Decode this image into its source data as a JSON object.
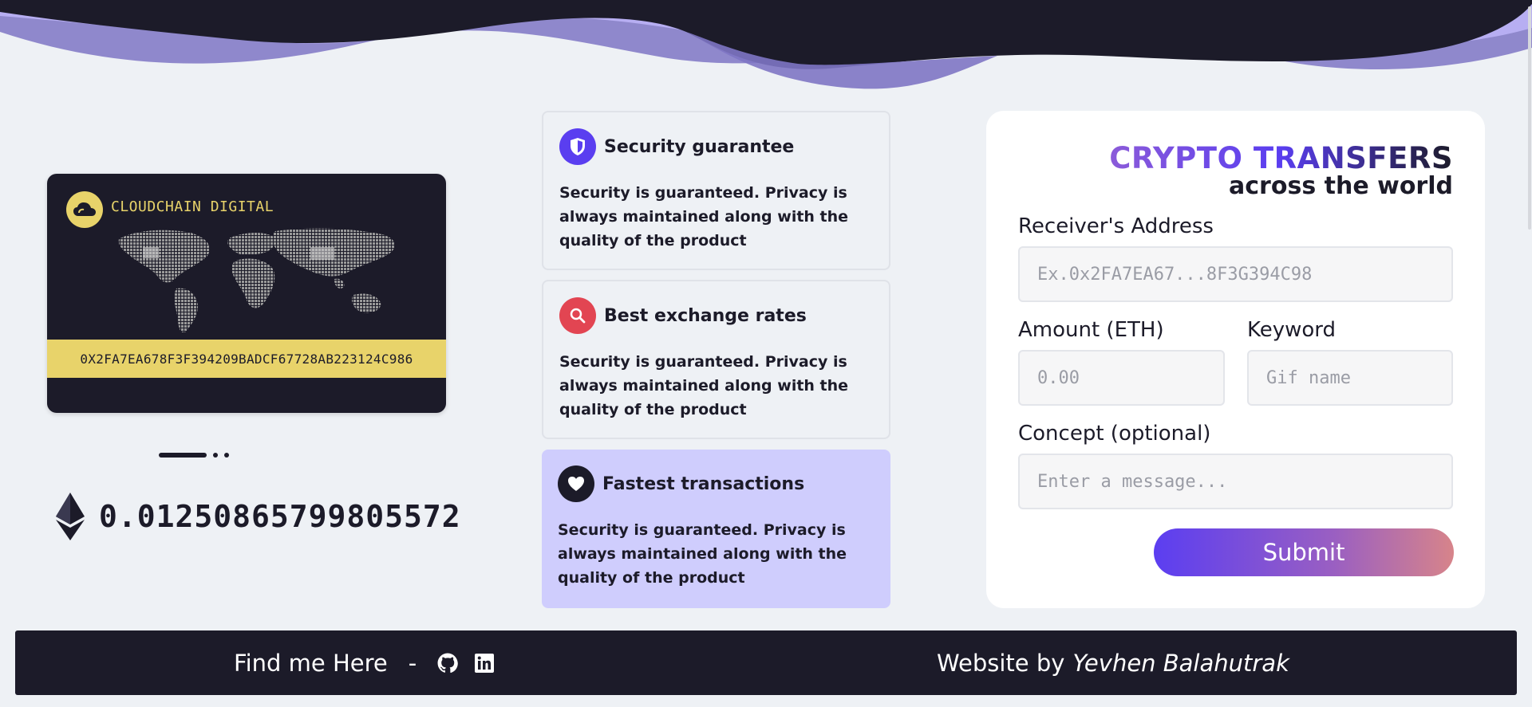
{
  "card": {
    "brand": "CLOUDCHAIN DIGITAL",
    "address": "0X2FA7EA678F3F394209BADCF67728AB223124C986"
  },
  "balance": {
    "value": "0.01250865799805572"
  },
  "features": [
    {
      "title": "Security guarantee",
      "text": "Security is guaranteed. Privacy is always maintained along with the quality of the product",
      "icon": "shield-icon",
      "icon_bg": "#5a3ef0"
    },
    {
      "title": "Best exchange rates",
      "text": "Security is guaranteed. Privacy is always maintained along with the quality of the product",
      "icon": "search-icon",
      "icon_bg": "#e24552"
    },
    {
      "title": "Fastest transactions",
      "text": "Security is guaranteed. Privacy is always maintained along with the quality of the product",
      "icon": "heart-icon",
      "icon_bg": "#1c1b29"
    }
  ],
  "form": {
    "title_line1": "CRYPTO TRANSFERS",
    "title_line2": "across the world",
    "receiver_label": "Receiver's Address",
    "receiver_placeholder": "Ex.0x2FA7EA67...8F3G394C98",
    "amount_label": "Amount (ETH)",
    "amount_placeholder": "0.00",
    "keyword_label": "Keyword",
    "keyword_placeholder": "Gif name",
    "concept_label": "Concept (optional)",
    "concept_placeholder": "Enter a message...",
    "submit_label": "Submit"
  },
  "footer": {
    "find_me": "Find me Here",
    "separator": "-",
    "website_by": "Website by",
    "author": "Yevhen Balahutrak"
  },
  "colors": {
    "dark": "#1c1b29",
    "accent": "#5a3ef0",
    "card_yellow": "#e8d36a",
    "highlight": "#cfcdfd"
  }
}
